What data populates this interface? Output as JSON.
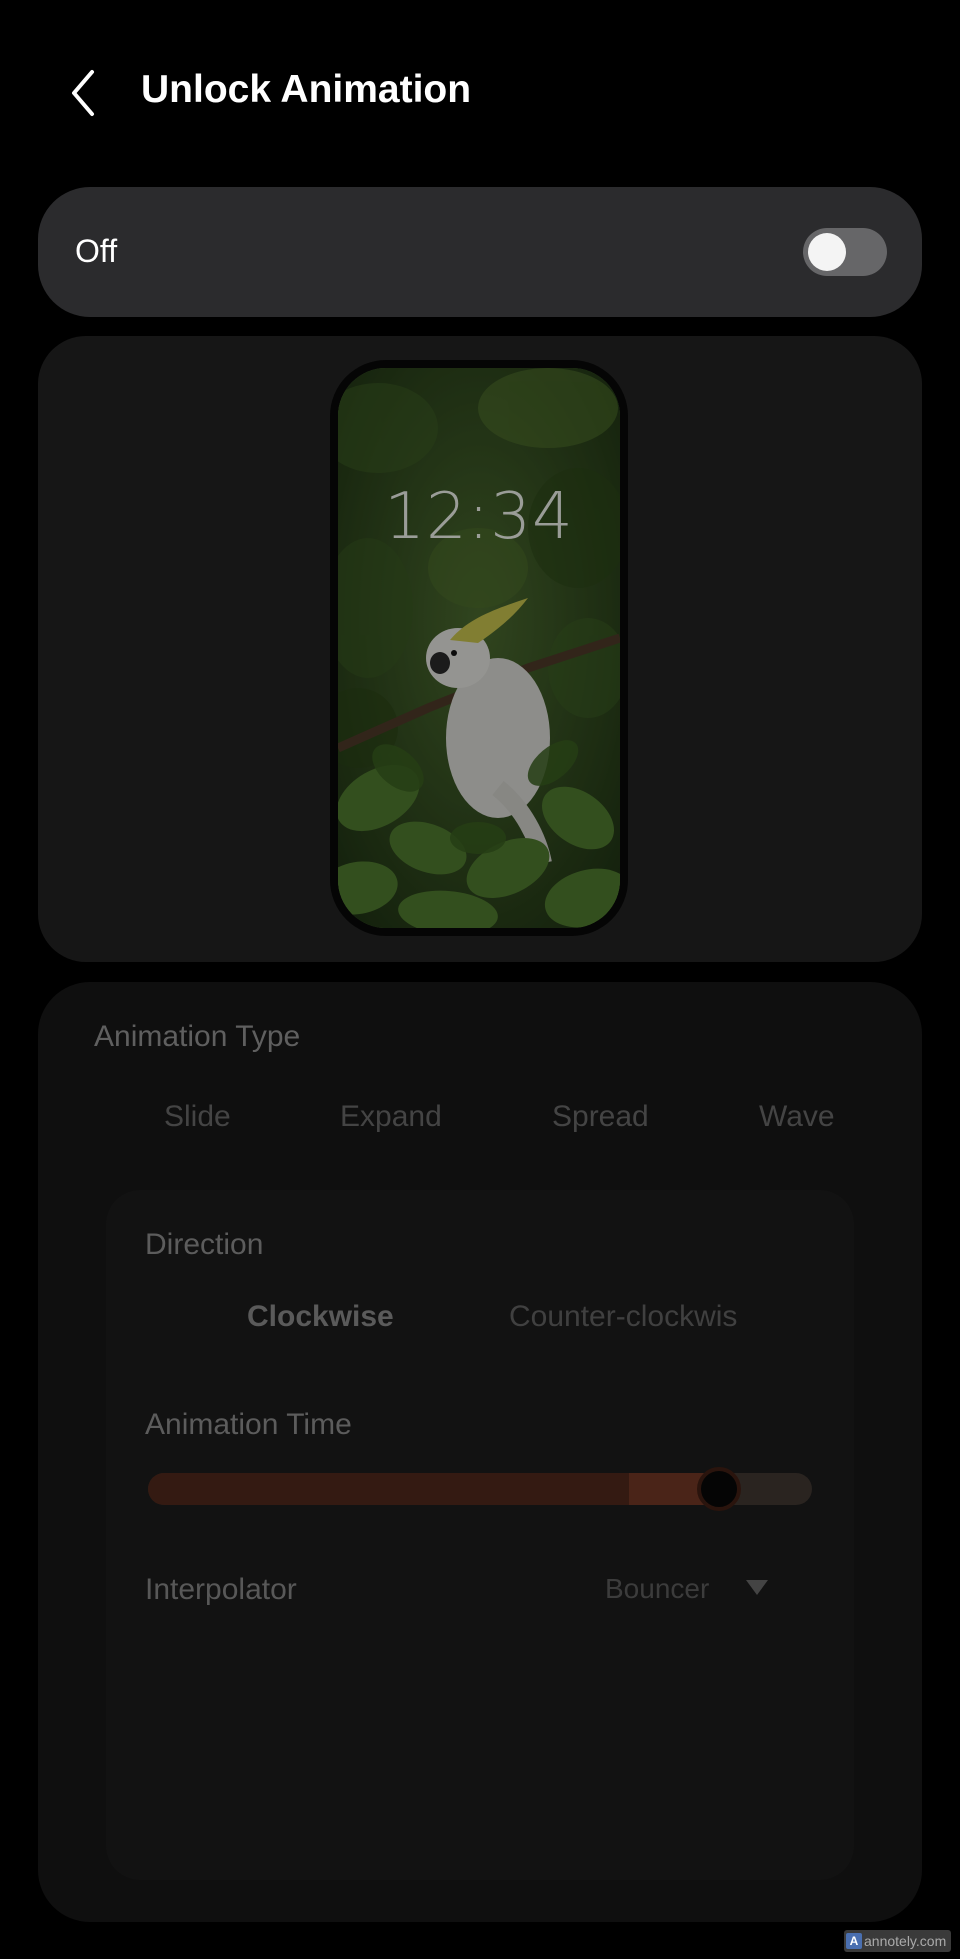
{
  "header": {
    "title": "Unlock Animation",
    "back_icon": "chevron-left-icon"
  },
  "master_switch": {
    "label": "Off",
    "checked": false
  },
  "preview": {
    "clock": "12:34"
  },
  "animation_type": {
    "label": "Animation Type",
    "tabs": [
      "Slide",
      "Expand",
      "Spread",
      "Wave"
    ]
  },
  "direction": {
    "label": "Direction",
    "options": [
      "Clockwise",
      "Counter-clockwis"
    ],
    "selected": "Clockwise"
  },
  "animation_time": {
    "label": "Animation Time",
    "value_fraction": 0.86
  },
  "interpolator": {
    "label": "Interpolator",
    "value": "Bouncer"
  },
  "watermark": {
    "text": "annotely.com"
  }
}
